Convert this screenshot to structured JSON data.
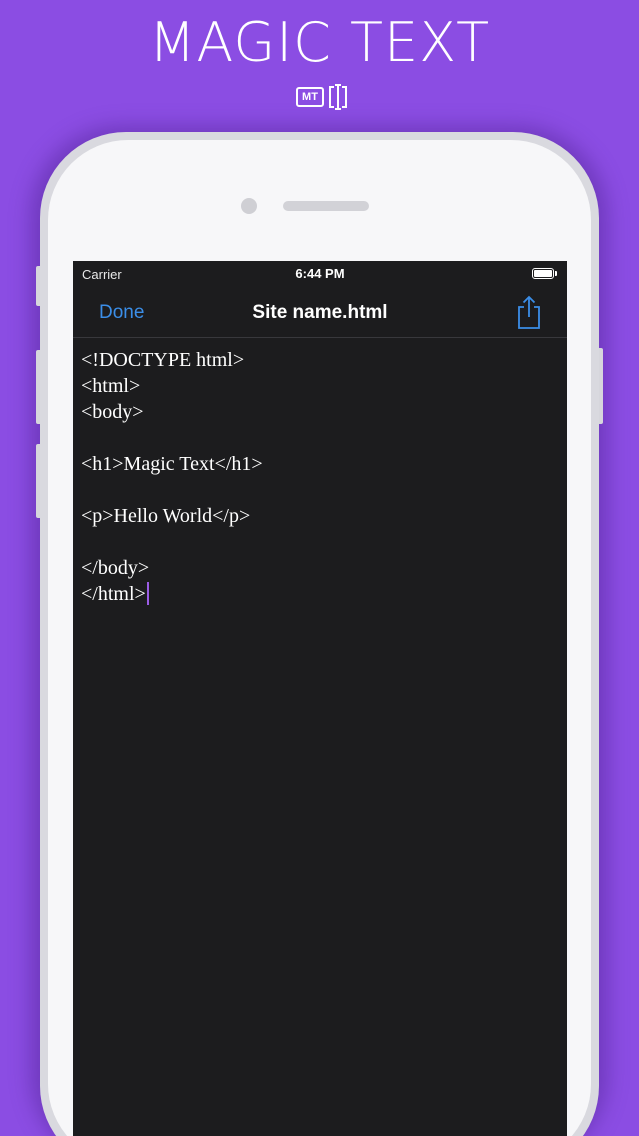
{
  "promo": {
    "headline": "MAGIC TEXT",
    "logo_letters": "MT"
  },
  "colors": {
    "background": "#8b4de3",
    "accent_blue": "#3b8ee8",
    "caret": "#9b5de5",
    "screen": "#1c1c1e"
  },
  "status_bar": {
    "carrier": "Carrier",
    "time": "6:44 PM",
    "battery_icon": "battery-full-icon"
  },
  "nav": {
    "done_label": "Done",
    "title": "Site name.html",
    "share_icon": "share-icon"
  },
  "editor": {
    "lines": [
      "<!DOCTYPE html>",
      "<html>",
      "<body>",
      "",
      "<h1>Magic Text</h1>",
      "",
      "<p>Hello World</p>",
      "",
      "</body>",
      "</html>"
    ]
  }
}
